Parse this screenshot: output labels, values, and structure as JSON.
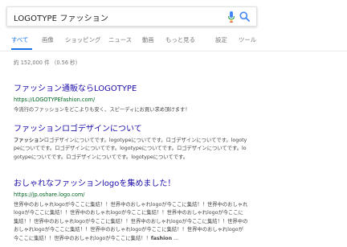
{
  "search": {
    "query": "LOGOTYPE ファッション"
  },
  "colors": {
    "accent": "#1a73e8",
    "link": "#1a0dab",
    "url": "#006621"
  },
  "tabs": [
    {
      "label": "すべて",
      "active": true
    },
    {
      "label": "画像"
    },
    {
      "label": "ショッピング"
    },
    {
      "label": "ニュース"
    },
    {
      "label": "動画"
    },
    {
      "label": "もっと見る"
    },
    {
      "label": "設定"
    },
    {
      "label": "ツール"
    }
  ],
  "stats": "約 152,000 件 （0.56 秒）",
  "results": [
    {
      "title": "ファッション通販ならLOGOTYPE",
      "url": "https://LOGOTYPEfashion.com/",
      "snippet": [
        "今流行のファッションをどこよりも安く、スピーディにお買い求め頂けます！"
      ]
    },
    {
      "title": "ファッションロゴデザインについて",
      "url": "",
      "snippet_bold": "ファッション",
      "snippet": [
        "ロゴデザインについてです。logotypeについてです。ロゴデザインについてです。logotypeについてです。ロゴデザインについてです。logotypeについてです。ロゴデザインについてです。logotypeについてです。ロゴデザインについてです。logotypeについてです。"
      ]
    },
    {
      "title": "おしゃれなファッションlogoを集めました！",
      "url": "https://jp.oshare.logo.com/",
      "snippet": [
        "世界中のおしゃれlogoが今ここに集結！！世界中のおしゃれlogoが今ここに集結！！世界中のおしゃれlogoが今ここに集結！！世界中のおしゃれlogoが今ここに集結！！世界中のおしゃれlogoが今ここに集結！！世界中のおしゃれlogoが今ここに集結！！世界中のおしゃれlogoが今ここに集結！！世界中のおしゃれlogoが今ここに集結！！世界中のおしゃれlogoが今ここに集結！！世界中のおしゃれlogoが今ここに集結！！世界中のおしゃれlogoが今ここに集結！！"
      ],
      "snippet_tail_bold": "fashion",
      "snippet_tail": " ..."
    }
  ]
}
